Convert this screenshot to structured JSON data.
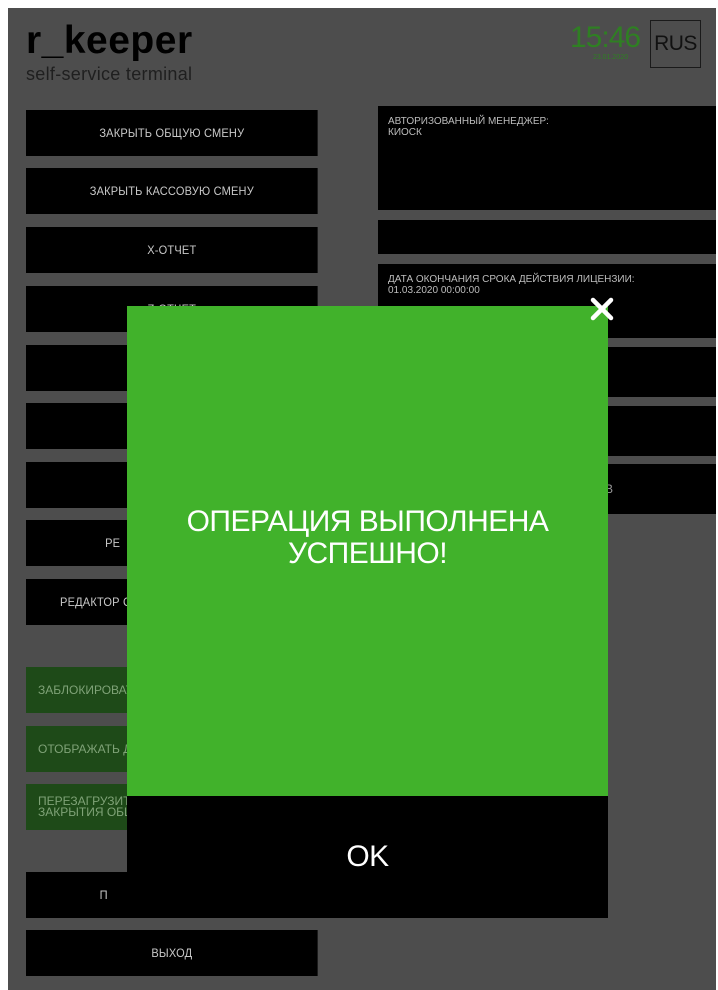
{
  "header": {
    "brand": "r_keeper",
    "subtitle": "self-service terminal",
    "time": "15:46",
    "date": "23.01.2020",
    "language": "RUS"
  },
  "left_buttons": [
    "ЗАКРЫТЬ ОБЩУЮ СМЕНУ",
    "ЗАКРЫТЬ КАССОВУЮ СМЕНУ",
    "X-ОТЧЕТ",
    "Z-ОТЧЕТ",
    "",
    "",
    "",
    "РЕ",
    "РЕДАКТОР С"
  ],
  "green_buttons": [
    "ЗАБЛОКИРОВАТ",
    "ОТОБРАЖАТЬ ДА",
    "ПЕРЕЗАГРУЗИТЬ\nЗАКРЫТИЯ ОБЩ"
  ],
  "bottom_buttons": [
    "П",
    "ВЫХОД"
  ],
  "right_panels": {
    "manager_label": "АВТОРИЗОВАННЫЙ МЕНЕДЖЕР:",
    "manager_value": "КИОСК",
    "license_label": "ДАТА ОКОНЧАНИЯ СРОКА ДЕЙСТВИЯ ЛИЦЕНЗИИ:",
    "license_value": "01.03.2020 00:00:00",
    "partial_tail": "В"
  },
  "modal": {
    "message": "ОПЕРАЦИЯ ВЫПОЛНЕНА УСПЕШНО!",
    "ok_label": "OK",
    "close_icon": "close-icon"
  },
  "colors": {
    "backdrop": "#4d4d4d",
    "modal_green": "#41b22b",
    "time_green": "#2f7f23",
    "button_black": "#000000",
    "green_button_dark": "#1e4a18"
  }
}
